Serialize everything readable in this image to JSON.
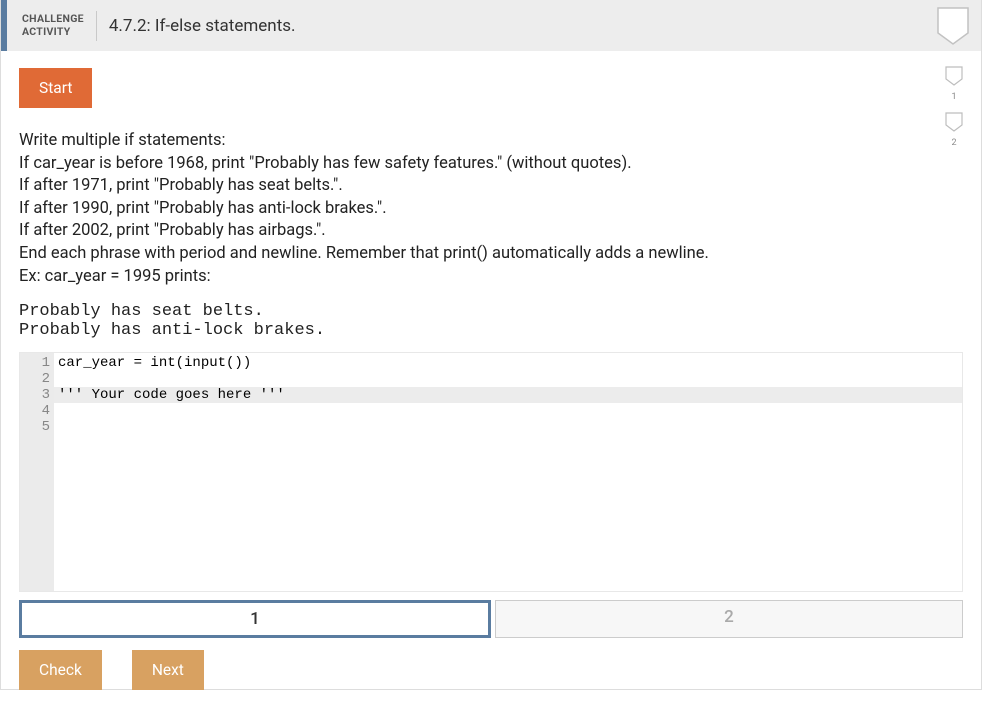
{
  "header": {
    "label_line1": "CHALLENGE",
    "label_line2": "ACTIVITY",
    "title": "4.7.2: If-else statements."
  },
  "buttons": {
    "start": "Start",
    "check": "Check",
    "next": "Next"
  },
  "instructions": {
    "line1": "Write multiple if statements:",
    "line2": "If car_year is before 1968, print \"Probably has few safety features.\" (without quotes).",
    "line3": "If after 1971, print \"Probably has seat belts.\".",
    "line4": "If after 1990, print \"Probably has anti-lock brakes.\".",
    "line5": "If after 2002, print \"Probably has airbags.\".",
    "line6": "End each phrase with period and newline. Remember that print() automatically adds a newline.",
    "line7": "Ex: car_year = 1995 prints:"
  },
  "example_output": "Probably has seat belts.\nProbably has anti-lock brakes.",
  "code": {
    "gutter": [
      "1",
      "2",
      "3",
      "4",
      "5"
    ],
    "lines": {
      "l1": "car_year = int(input())",
      "l2": "",
      "l3": "''' Your code goes here '''",
      "l4": "",
      "l5": ""
    }
  },
  "tabs": {
    "t1": "1",
    "t2": "2"
  },
  "side": {
    "s1": "1",
    "s2": "2"
  }
}
